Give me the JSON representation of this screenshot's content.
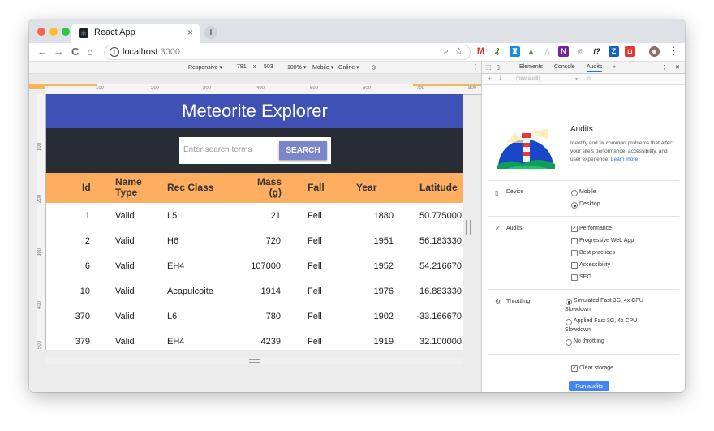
{
  "browser": {
    "tab_title": "React App",
    "tab_close": "×",
    "new_tab": "+",
    "url_host": "localhost",
    "url_port": ":3000",
    "back": "←",
    "forward": "→",
    "reload": "C",
    "home": "⌂"
  },
  "device_toolbar": {
    "device": "Responsive ▾",
    "width": "791",
    "times": "x",
    "height": "503",
    "zoom": "100% ▾",
    "mode": "Mobile ▾",
    "network": "Online ▾"
  },
  "rulers": {
    "top": [
      "100",
      "200",
      "300",
      "400",
      "500",
      "600",
      "700",
      "800"
    ],
    "left": [
      "100",
      "200",
      "300",
      "400",
      "500"
    ]
  },
  "app": {
    "title": "Meteorite Explorer",
    "search_placeholder": "Enter search terms",
    "search_button": "SEARCH",
    "columns": {
      "id": "Id",
      "name_type": [
        "Name",
        "Type"
      ],
      "rec_class": "Rec Class",
      "mass": [
        "Mass",
        "(g)"
      ],
      "fall": "Fall",
      "year": "Year",
      "latitude": "Latitude"
    },
    "rows": [
      {
        "id": "1",
        "nametype": "Valid",
        "recclass": "L5",
        "mass": "21",
        "fall": "Fell",
        "year": "1880",
        "lat": "50.775000"
      },
      {
        "id": "2",
        "nametype": "Valid",
        "recclass": "H6",
        "mass": "720",
        "fall": "Fell",
        "year": "1951",
        "lat": "56.183330"
      },
      {
        "id": "6",
        "nametype": "Valid",
        "recclass": "EH4",
        "mass": "107000",
        "fall": "Fell",
        "year": "1952",
        "lat": "54.216670"
      },
      {
        "id": "10",
        "nametype": "Valid",
        "recclass": "Acapulcoite",
        "mass": "1914",
        "fall": "Fell",
        "year": "1976",
        "lat": "16.883330"
      },
      {
        "id": "370",
        "nametype": "Valid",
        "recclass": "L6",
        "mass": "780",
        "fall": "Fell",
        "year": "1902",
        "lat": "-33.166670"
      },
      {
        "id": "379",
        "nametype": "Valid",
        "recclass": "EH4",
        "mass": "4239",
        "fall": "Fell",
        "year": "1919",
        "lat": "32.100000"
      }
    ]
  },
  "devtools": {
    "tabs": {
      "elements": "Elements",
      "console": "Console",
      "audits": "Audits",
      "more": "»"
    },
    "new_audit": "(new audit)",
    "audits_title": "Audits",
    "audits_desc": "Identify and fix common problems that affect your site's performance, accessibility, and user experience.",
    "learn_more": "Learn more",
    "device": {
      "label": "Device",
      "options": [
        "Mobile",
        "Desktop"
      ],
      "selected": "Desktop"
    },
    "audits": {
      "label": "Audits",
      "options": [
        "Performance",
        "Progressive Web App",
        "Best practices",
        "Accessibility",
        "SEO"
      ],
      "checked": [
        "Performance"
      ]
    },
    "throttling": {
      "label": "Throttling",
      "opt1_line1": "Simulated Fast 3G, 4x CPU",
      "opt1_line2": "Slowdown",
      "opt2_line1": "Applied Fast 3G, 4x CPU",
      "opt2_line2": "Slowdown",
      "opt3": "No throttling",
      "selected": "Simulated Fast 3G, 4x CPU Slowdown"
    },
    "clear_storage": "Clear storage",
    "run_button": "Run audits"
  },
  "colors": {
    "header": "#3f51b5",
    "search_band": "#282c34",
    "table_header": "#ffad60",
    "search_button": "#7986cb",
    "run_button": "#4285f4"
  }
}
